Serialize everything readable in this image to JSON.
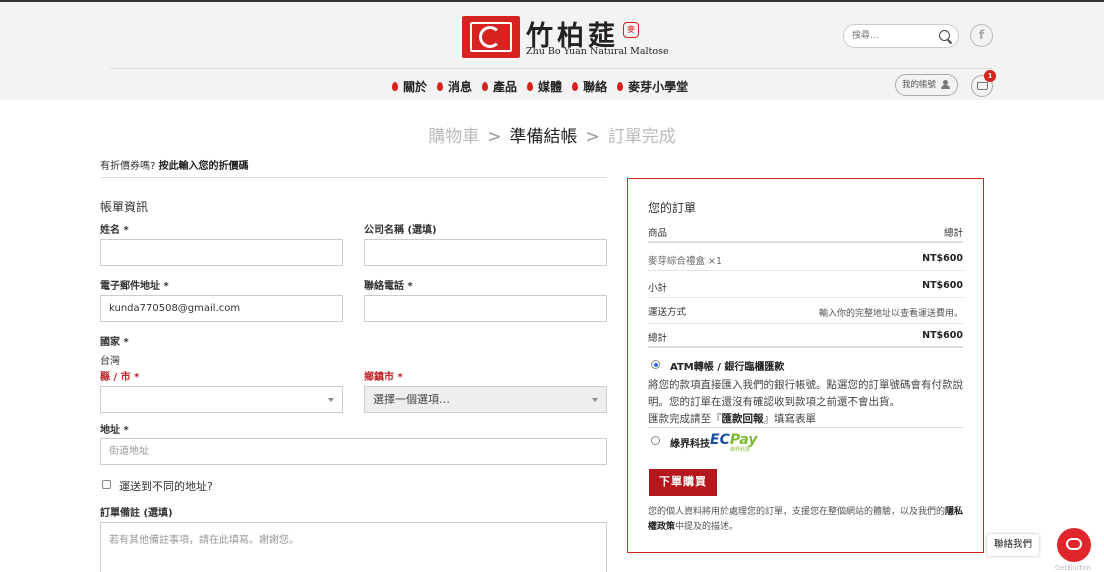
{
  "brand": {
    "name_cn": "竹柏莚",
    "seal": "麥",
    "name_en": "Zhu Bo Yuan Natural Maltose"
  },
  "search": {
    "placeholder": "搜尋..."
  },
  "social": {
    "facebook": "f"
  },
  "nav": [
    "關於",
    "消息",
    "產品",
    "媒體",
    "聯絡",
    "麥芽小學堂"
  ],
  "account": {
    "label": "我的帳號"
  },
  "cart": {
    "count": "1"
  },
  "steps": {
    "cart": "購物車",
    "checkout": "準備結帳",
    "complete": "訂單完成",
    "arrow": ">"
  },
  "coupon": {
    "question": "有折價券嗎?",
    "link": "按此輸入您的折價碼"
  },
  "billing": {
    "heading": "帳單資訊",
    "name_label": "姓名 *",
    "company_label": "公司名稱 (選填)",
    "email_label": "電子郵件地址 *",
    "email_value": "kunda770508@gmail.com",
    "phone_label": "聯絡電話 *",
    "country_label": "國家 *",
    "country_value": "台灣",
    "county_label": "縣 / 市 *",
    "town_label": "鄉鎮市 *",
    "town_placeholder": "選擇一個選項…",
    "address_label": "地址 *",
    "address_placeholder": "街道地址",
    "ship_different": "運送到不同的地址?",
    "notes_label": "訂單備註 (選填)",
    "notes_placeholder": "若有其他備註事項，請在此填寫。謝謝您。"
  },
  "order": {
    "title": "您的訂單",
    "col_product": "商品",
    "col_total": "總計",
    "item_name": "麥芽綜合禮盒 ×1",
    "item_price": "NT$600",
    "subtotal_label": "小計",
    "subtotal_value": "NT$600",
    "shipping_label": "運送方式",
    "shipping_value": "輸入你的完整地址以查看運送費用。",
    "total_label": "總計",
    "total_value": "NT$600",
    "pay_atm": "ATM轉帳 / 銀行臨櫃匯款",
    "pay_atm_desc1": "將您的款項直接匯入我們的銀行帳號。點選您的訂單號碼會有付款說明。您的訂單在還沒有確認收到款項之前還不會出貨。",
    "pay_atm_desc2a": "匯款完成請至『",
    "pay_atm_desc2b": "匯款回報",
    "pay_atm_desc2c": "』填寫表單",
    "pay_ecpay": "綠界科技",
    "ecpay_logo_a": "EC",
    "ecpay_logo_b": "Pay",
    "ecpay_logo_small": "綠界科技",
    "place_order": "下單購買",
    "privacy_a": "您的個人資料將用於處理您的訂單，支援您在整個網站的體驗，以及我們的",
    "privacy_b": "隱私權政策",
    "privacy_c": "中提及的描述。"
  },
  "contact": {
    "label": "聯絡我們",
    "powered": "GetButton"
  },
  "colors": {
    "brand_red": "#d7231f",
    "button_red": "#b5171c",
    "radio_blue": "#2b6de4"
  }
}
